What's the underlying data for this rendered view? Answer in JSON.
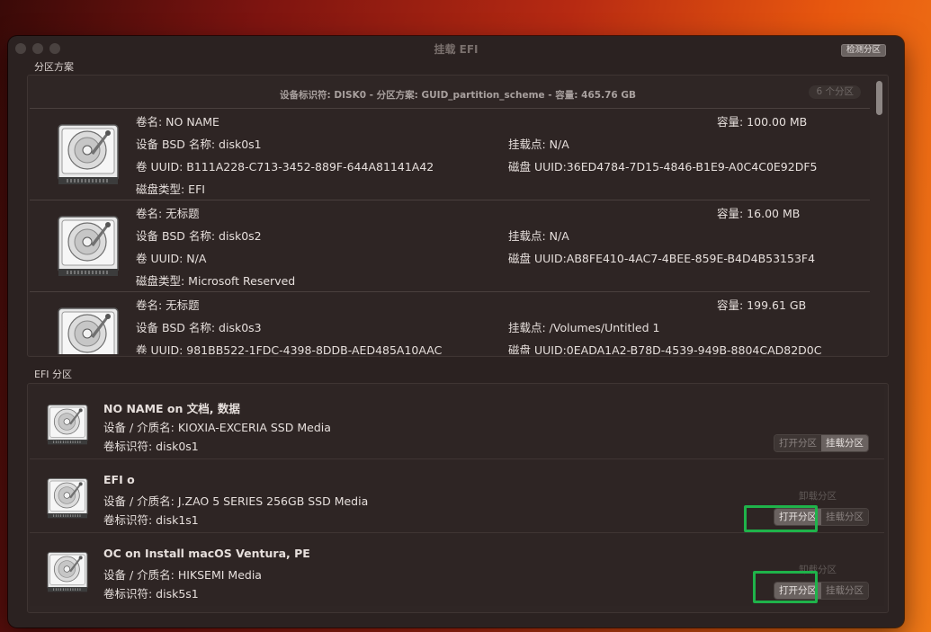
{
  "window": {
    "title": "挂载 EFI",
    "detect_button": "检测分区"
  },
  "partition_section": {
    "label": "分区方案",
    "header": "设备标识符: DISK0 - 分区方案: GUID_partition_scheme - 容量: 465.76 GB",
    "count_badge": "6 个分区",
    "rows": [
      {
        "name": "卷名: NO NAME",
        "capacity": "容量:  100.00 MB",
        "bsd": "设备 BSD 名称: disk0s1",
        "mount": "挂载点: N/A",
        "uuid": "卷 UUID: B111A228-C713-3452-889F-644A81141A42",
        "disk_uuid": "磁盘 UUID:36ED4784-7D15-4846-B1E9-A0C4C0E92DF5",
        "type": "磁盘类型: EFI"
      },
      {
        "name": "卷名: 无标题",
        "capacity": "容量:  16.00 MB",
        "bsd": "设备 BSD 名称: disk0s2",
        "mount": "挂载点: N/A",
        "uuid": "卷 UUID: N/A",
        "disk_uuid": "磁盘 UUID:AB8FE410-4AC7-4BEE-859E-B4D4B53153F4",
        "type": "磁盘类型: Microsoft Reserved"
      },
      {
        "name": "卷名: 无标题",
        "capacity": "容量:  199.61 GB",
        "bsd": "设备 BSD 名称: disk0s3",
        "mount": "挂载点: /Volumes/Untitled 1",
        "uuid": "卷 UUID: 981BB522-1FDC-4398-8DDB-AED485A10AAC",
        "disk_uuid": "磁盘 UUID:0EADA1A2-B78D-4539-949B-8804CAD82D0C",
        "type": ""
      }
    ]
  },
  "efi_section": {
    "label": "EFI 分区",
    "rows": [
      {
        "name": "NO NAME on 文档, 数据",
        "media": "设备 / 介质名: KIOXIA-EXCERIA SSD Media",
        "identifier": "卷标识符: disk0s1",
        "open_label": "打开分区",
        "mount_label": "挂载分区",
        "unmount_label": ""
      },
      {
        "name": "EFI o",
        "media": "设备 / 介质名: J.ZAO 5 SERIES 256GB SSD Media",
        "identifier": "卷标识符: disk1s1",
        "open_label": "打开分区",
        "mount_label": "挂载分区",
        "unmount_label": "卸载分区"
      },
      {
        "name": "OC on Install macOS Ventura, PE",
        "media": "设备 / 介质名: HIKSEMI Media",
        "identifier": "卷标识符: disk5s1",
        "open_label": "打开分区",
        "mount_label": "挂载分区",
        "unmount_label": "卸载分区"
      }
    ]
  },
  "colors": {
    "highlight": "#1fb34a",
    "window_bg": "#2b2221"
  }
}
